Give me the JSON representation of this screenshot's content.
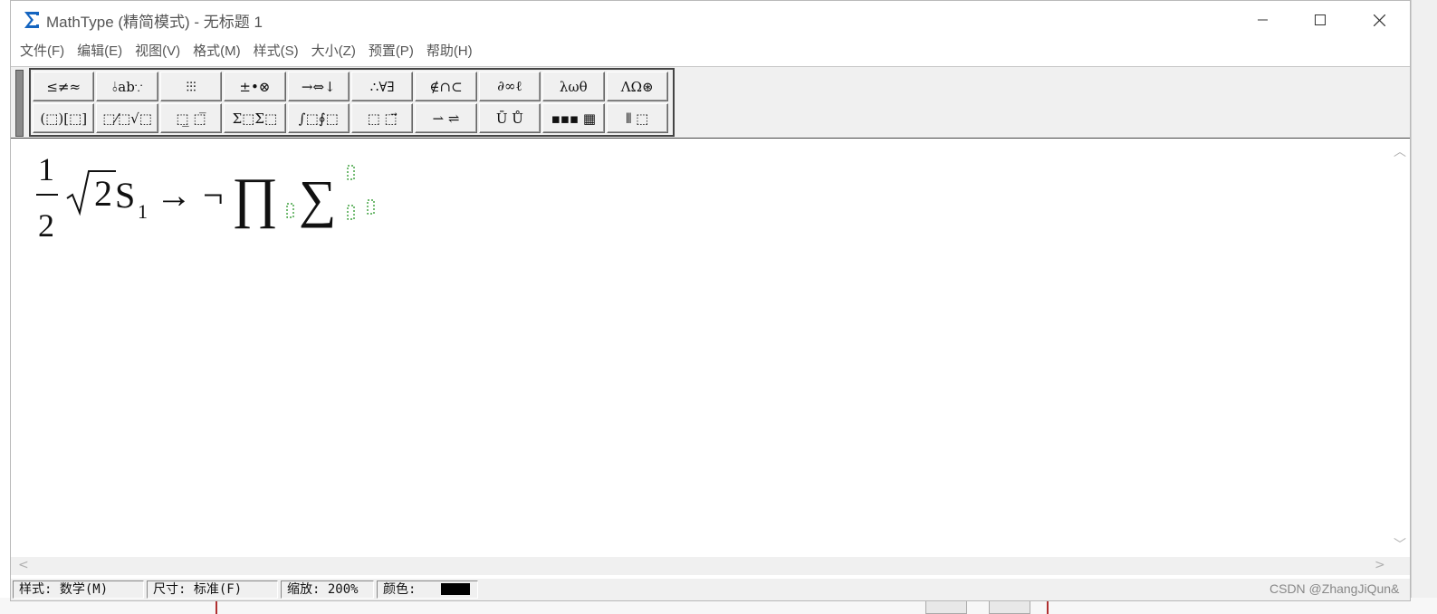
{
  "window": {
    "title": "MathType (精简模式) - 无标题 1",
    "icon": "sigma-icon"
  },
  "menu": [
    {
      "label": "文件(F)"
    },
    {
      "label": "编辑(E)"
    },
    {
      "label": "视图(V)"
    },
    {
      "label": "格式(M)"
    },
    {
      "label": "样式(S)"
    },
    {
      "label": "大小(Z)"
    },
    {
      "label": "预置(P)"
    },
    {
      "label": "帮助(H)"
    }
  ],
  "palettes": {
    "row1": [
      "≤≠≈",
      "⫰ab∵",
      "⫶⫶⫶",
      "±•⊗",
      "→⇔↓",
      "∴∀∃",
      "∉∩⊂",
      "∂∞ℓ",
      "λωθ",
      "ΛΩ⊛"
    ],
    "row2": [
      "(⬚)[⬚]",
      "⬚⁄⬚√⬚",
      "⬚̲ ⬚̅",
      "Σ⬚Σ⬚",
      "∫⬚∮⬚",
      "⬚ ⬚⃗",
      "⇀ ⇌",
      "Ū Ů",
      "▪▪▪ ▦",
      "⫴ ⬚"
    ]
  },
  "formula": {
    "numerator": "1",
    "denominator": "2",
    "radicand": "2",
    "letter": "S",
    "subscript": "1",
    "arrow": "→",
    "neg": "¬",
    "product": "∏",
    "sum": "∑"
  },
  "status": {
    "style_label": "样式: 数学(M)",
    "size_label": "尺寸: 标准(F)",
    "zoom_label": "缩放: 200%",
    "color_label": "颜色:",
    "color_value": "#000000"
  },
  "watermark": "CSDN @ZhangJiQun&",
  "colors": {
    "titlebar": "#ffffff",
    "toolbar": "#f0f0f0",
    "placeholder": "#1a8f1a",
    "icon_blue": "#1565c0"
  }
}
